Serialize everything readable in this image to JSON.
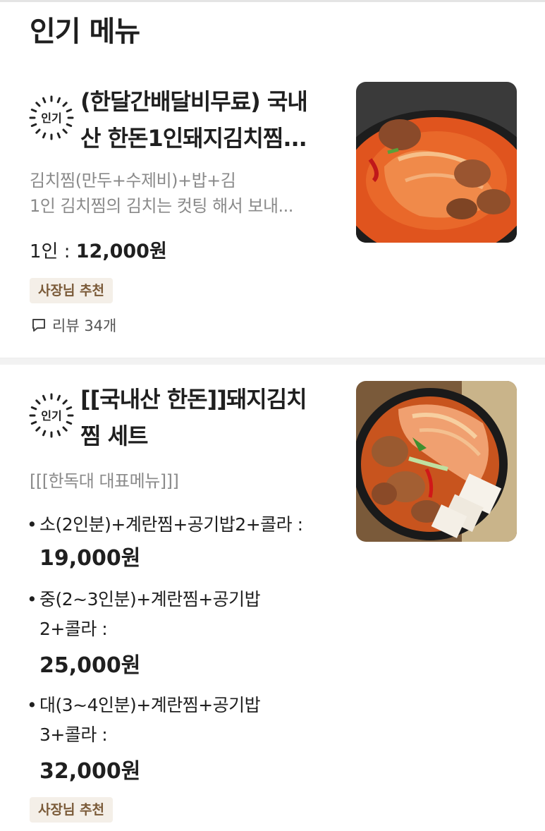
{
  "header": {
    "title": "인기 메뉴"
  },
  "badge_label": "인기",
  "items": [
    {
      "name_line1": "(한달간배달비무료) 국내",
      "name_line2": "산 한돈1인돼지김치찜...",
      "desc_line1": "김치찜(만두+수제비)+밥+김",
      "desc_line2": "1인 김치찜의 김치는 컷팅 해서 보내...",
      "price_prefix": "1인 : ",
      "price": "12,000원",
      "tag": "사장님 추천",
      "review": "리뷰 34개",
      "image": "kimchi-jjim-bowl"
    },
    {
      "name_line1": "[[국내산 한돈]]돼지김치",
      "name_line2": "찜 세트",
      "desc_line1": "[[[한독대 대표메뉴]]]",
      "options": [
        {
          "line1": "소(2인분)+계란찜+공기밥2+콜라 :",
          "line2": "",
          "price": "19,000원"
        },
        {
          "line1": "중(2~3인분)+계란찜+공기밥",
          "line2": "2+콜라 :",
          "price": "25,000원"
        },
        {
          "line1": "대(3~4인분)+계란찜+공기밥",
          "line2": "3+콜라 :",
          "price": "32,000원"
        }
      ],
      "bullet": "•",
      "tag": "사장님 추천",
      "image": "kimchi-jjim-set-pot"
    }
  ],
  "colors": {
    "tag_bg": "#f4efe8",
    "tag_text": "#7a5a38",
    "desc": "#8a8a8a"
  },
  "icons": {
    "badge": "popular-sun-badge-icon",
    "review": "speech-bubble-icon"
  }
}
